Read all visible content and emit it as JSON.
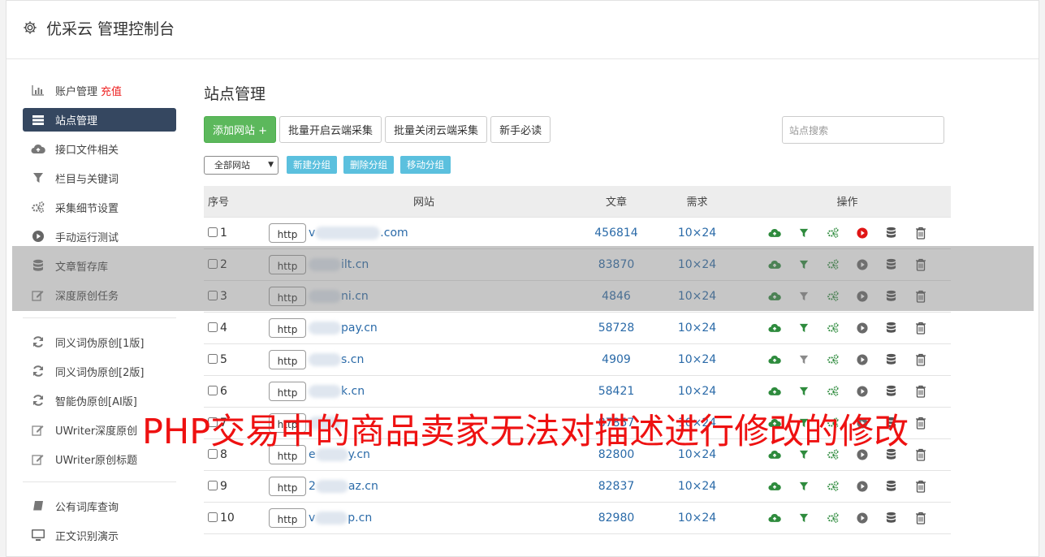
{
  "header": {
    "title": "优采云 管理控制台",
    "icon": "gear-icon"
  },
  "sidebar": {
    "group1": [
      {
        "label": "账户管理",
        "extra": "充值",
        "icon": "bar-chart-icon"
      },
      {
        "label": "站点管理",
        "icon": "server-list-icon",
        "active": true
      },
      {
        "label": "接口文件相关",
        "icon": "cloud-upload-icon"
      },
      {
        "label": "栏目与关键词",
        "icon": "filter-icon"
      },
      {
        "label": "采集细节设置",
        "icon": "cogs-icon"
      },
      {
        "label": "手动运行测试",
        "icon": "play-icon"
      },
      {
        "label": "文章暂存库",
        "icon": "database-icon"
      },
      {
        "label": "深度原创任务",
        "icon": "edit-icon"
      }
    ],
    "group2": [
      {
        "label": "同义词伪原创[1版]",
        "icon": "refresh-icon"
      },
      {
        "label": "同义词伪原创[2版]",
        "icon": "refresh-icon"
      },
      {
        "label": "智能伪原创[AI版]",
        "icon": "refresh-icon"
      },
      {
        "label": "UWriter深度原创",
        "icon": "edit-icon"
      },
      {
        "label": "UWriter原创标题",
        "icon": "edit-icon"
      }
    ],
    "group3": [
      {
        "label": "公有词库查询",
        "icon": "book-icon"
      },
      {
        "label": "正文识别演示",
        "icon": "monitor-icon"
      }
    ]
  },
  "main": {
    "title": "站点管理",
    "buttons": {
      "add": "添加网站 +",
      "enable_cloud": "批量开启云端采集",
      "disable_cloud": "批量关闭云端采集",
      "guide": "新手必读"
    },
    "search_placeholder": "站点搜索",
    "group_select": "全部网站",
    "group_buttons": {
      "new": "新建分组",
      "delete": "删除分组",
      "move": "移动分组"
    },
    "columns": [
      "序号",
      "网站",
      "文章",
      "需求",
      "操作"
    ],
    "rows": [
      {
        "no": "1",
        "protocol": "http",
        "site_prefix": "v",
        "site_suffix": ".com",
        "articles": "456814",
        "demand": "10×24",
        "filter_active": true,
        "play_active": true
      },
      {
        "no": "2",
        "protocol": "http",
        "site_prefix": "",
        "site_suffix": "ilt.cn",
        "articles": "83870",
        "demand": "10×24",
        "filter_active": true,
        "play_active": false
      },
      {
        "no": "3",
        "protocol": "http",
        "site_prefix": "",
        "site_suffix": "ni.cn",
        "articles": "4846",
        "demand": "10×24",
        "filter_active": false,
        "play_active": false
      },
      {
        "no": "4",
        "protocol": "http",
        "site_prefix": "",
        "site_suffix": "pay.cn",
        "articles": "58728",
        "demand": "10×24",
        "filter_active": true,
        "play_active": false
      },
      {
        "no": "5",
        "protocol": "http",
        "site_prefix": "",
        "site_suffix": "s.cn",
        "articles": "4909",
        "demand": "10×24",
        "filter_active": false,
        "play_active": false
      },
      {
        "no": "6",
        "protocol": "http",
        "site_prefix": "",
        "site_suffix": "k.cn",
        "articles": "58421",
        "demand": "10×24",
        "filter_active": true,
        "play_active": false
      },
      {
        "no": "7",
        "protocol": "http",
        "site_prefix": "",
        "site_suffix": "",
        "articles": "87857",
        "demand": "10×24",
        "filter_active": true,
        "play_active": false
      },
      {
        "no": "8",
        "protocol": "http",
        "site_prefix": "e",
        "site_suffix": "y.cn",
        "articles": "82800",
        "demand": "10×24",
        "filter_active": true,
        "play_active": false
      },
      {
        "no": "9",
        "protocol": "http",
        "site_prefix": "2",
        "site_suffix": "az.cn",
        "articles": "82837",
        "demand": "10×24",
        "filter_active": true,
        "play_active": false
      },
      {
        "no": "10",
        "protocol": "http",
        "site_prefix": "v",
        "site_suffix": "p.cn",
        "articles": "82980",
        "demand": "10×24",
        "filter_active": true,
        "play_active": false
      }
    ]
  },
  "watermark": "PHP交易中的商品卖家无法对描述进行修改的修改",
  "colors": {
    "active_nav": "#354760",
    "green": "#5cb85c",
    "link": "#2a6aa8",
    "info": "#5bc0de",
    "red": "#e11111"
  }
}
